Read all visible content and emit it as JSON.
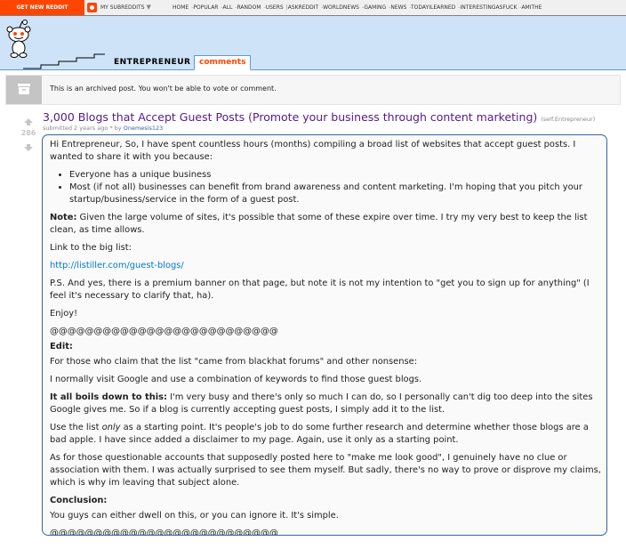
{
  "srbar": {
    "get_reddit": "GET NEW REDDIT",
    "my_subreddits": "MY SUBREDDITS",
    "links": [
      "HOME",
      "POPULAR",
      "ALL",
      "RANDOM",
      "USERS"
    ],
    "subs": [
      "ASKREDDIT",
      "WORLDNEWS",
      "GAMING",
      "NEWS",
      "TODAYILEARNED",
      "INTERESTINGASFUCK",
      "AMITHE"
    ]
  },
  "header": {
    "subreddit": "ENTREPRENEUR",
    "tab": "comments"
  },
  "archived": {
    "text": "This is an archived post. You won't be able to vote or comment."
  },
  "post": {
    "score": "286",
    "title": "3,000 Blogs that Accept Guest Posts (Promote your business through content marketing)",
    "domain": "(self.Entrepreneur)",
    "tagline_prefix": "submitted 2 years ago * by",
    "author": "Onemesis123"
  },
  "body": {
    "intro": "Hi Entrepreneur, So, I have spent countless hours (months) compiling a broad list of websites that accept guest posts. I wanted to share it with you because:",
    "bullets": [
      "Everyone has a unique business",
      "Most (if not all) businesses can benefit from brand awareness and content marketing. I'm hoping that you pitch your startup/business/service in the form of a guest post."
    ],
    "note_label": "Note:",
    "note_text": " Given the large volume of sites, it's possible that some of these expire over time. I try my very best to keep the list clean, as time allows.",
    "link_label": "Link to the big list:",
    "link_url": "http://listiller.com/guest-blogs/",
    "ps": "P.S. And yes, there is a premium banner on that page, but note it is not my intention to \"get you to sign up for anything\" (I feel it's necessary to clarify that, ha).",
    "enjoy": "Enjoy!",
    "ats_1": "@@@@@@@@@@@@@@@@@@@@@@@@@@",
    "edit_label": "Edit:",
    "edit_1": "For those who claim that the list \"came from blackhat forums\" and other nonsense:",
    "edit_2": "I normally visit Google and use a combination of keywords to find those guest blogs.",
    "boils_label": "It all boils down to this:",
    "boils_text": " I'm very busy and there's only so much I can do, so I personally can't dig too deep into the sites Google gives me. So if a blog is currently accepting guest posts, I simply add it to the list.",
    "use_pre": "Use the list ",
    "use_em": "only",
    "use_post": " as a starting point. It's people's job to do some further research and determine whether those blogs are a bad apple. I have since added a disclaimer to my page. Again, use it only as a starting point.",
    "questionable": "As for those questionable accounts that supposedly posted here to \"make me look good\", I genuinely have no clue or association with them. I was actually surprised to see them myself. But sadly, there's no way to prove or disprove my claims, which is why im leaving that subject alone.",
    "conclusion_label": "Conclusion:",
    "conclusion_text": "You guys can either dwell on this, or you can ignore it. It's simple.",
    "ats_2": "@@@@@@@@@@@@@@@@@@@@@@@@@@"
  }
}
